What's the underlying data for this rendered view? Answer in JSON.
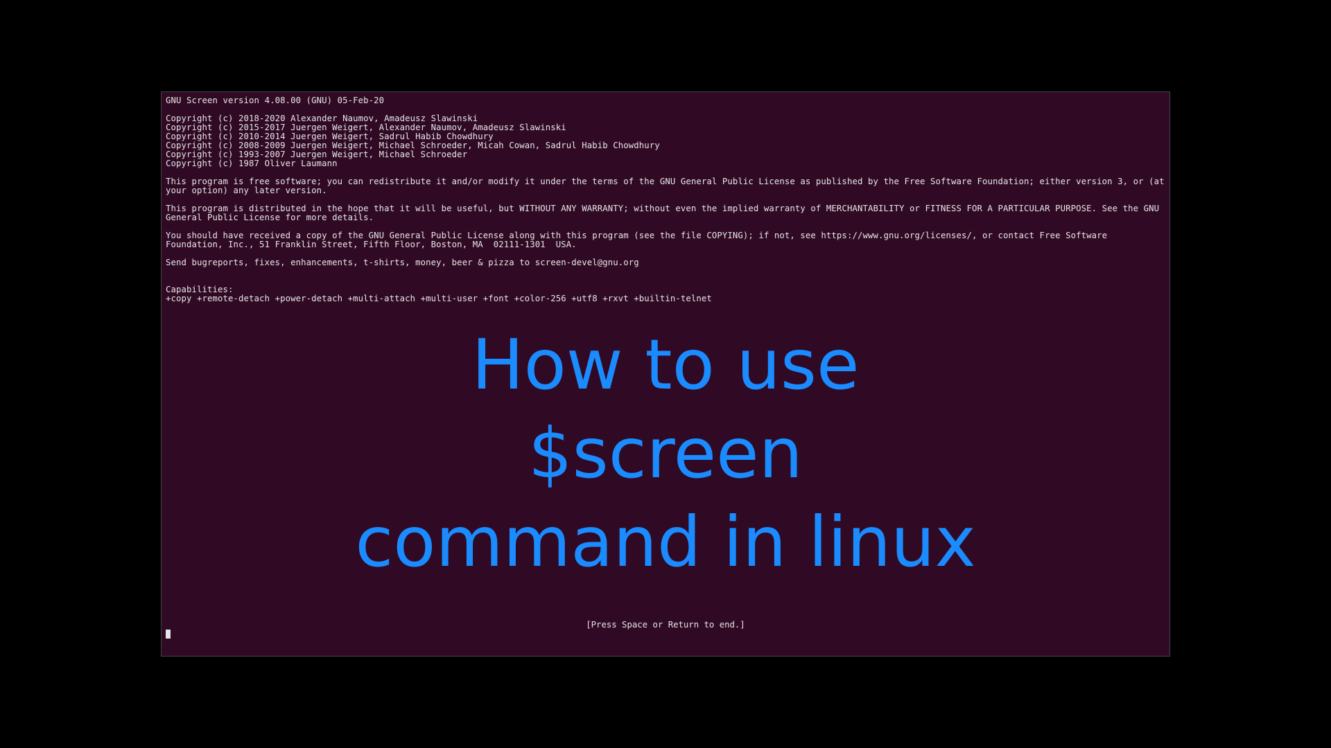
{
  "terminal": {
    "version_line": "GNU Screen version 4.08.00 (GNU) 05-Feb-20",
    "blank1": "",
    "copyright1": "Copyright (c) 2018-2020 Alexander Naumov, Amadeusz Slawinski",
    "copyright2": "Copyright (c) 2015-2017 Juergen Weigert, Alexander Naumov, Amadeusz Slawinski",
    "copyright3": "Copyright (c) 2010-2014 Juergen Weigert, Sadrul Habib Chowdhury",
    "copyright4": "Copyright (c) 2008-2009 Juergen Weigert, Michael Schroeder, Micah Cowan, Sadrul Habib Chowdhury",
    "copyright5": "Copyright (c) 1993-2007 Juergen Weigert, Michael Schroeder",
    "copyright6": "Copyright (c) 1987 Oliver Laumann",
    "blank2": "",
    "license1": "This program is free software; you can redistribute it and/or modify it under the terms of the GNU General Public License as published by the Free Software Foundation; either version 3, or (at your option) any later version.",
    "blank3": "",
    "license2": "This program is distributed in the hope that it will be useful, but WITHOUT ANY WARRANTY; without even the implied warranty of MERCHANTABILITY or FITNESS FOR A PARTICULAR PURPOSE. See the GNU General Public License for more details.",
    "blank4": "",
    "license3": "You should have received a copy of the GNU General Public License along with this program (see the file COPYING); if not, see https://www.gnu.org/licenses/, or contact Free Software Foundation, Inc., 51 Franklin Street, Fifth Floor, Boston, MA  02111-1301  USA.",
    "blank5": "",
    "bugreports": "Send bugreports, fixes, enhancements, t-shirts, money, beer & pizza to screen-devel@gnu.org",
    "blank6": "",
    "blank7": "",
    "capabilities_label": "Capabilities:",
    "capabilities": "+copy +remote-detach +power-detach +multi-attach +multi-user +font +color-256 +utf8 +rxvt +builtin-telnet"
  },
  "overlay": {
    "line1": "How to use",
    "line2": "$screen",
    "line3": "command in linux"
  },
  "status": {
    "prompt": "[Press Space or Return to end.]"
  }
}
